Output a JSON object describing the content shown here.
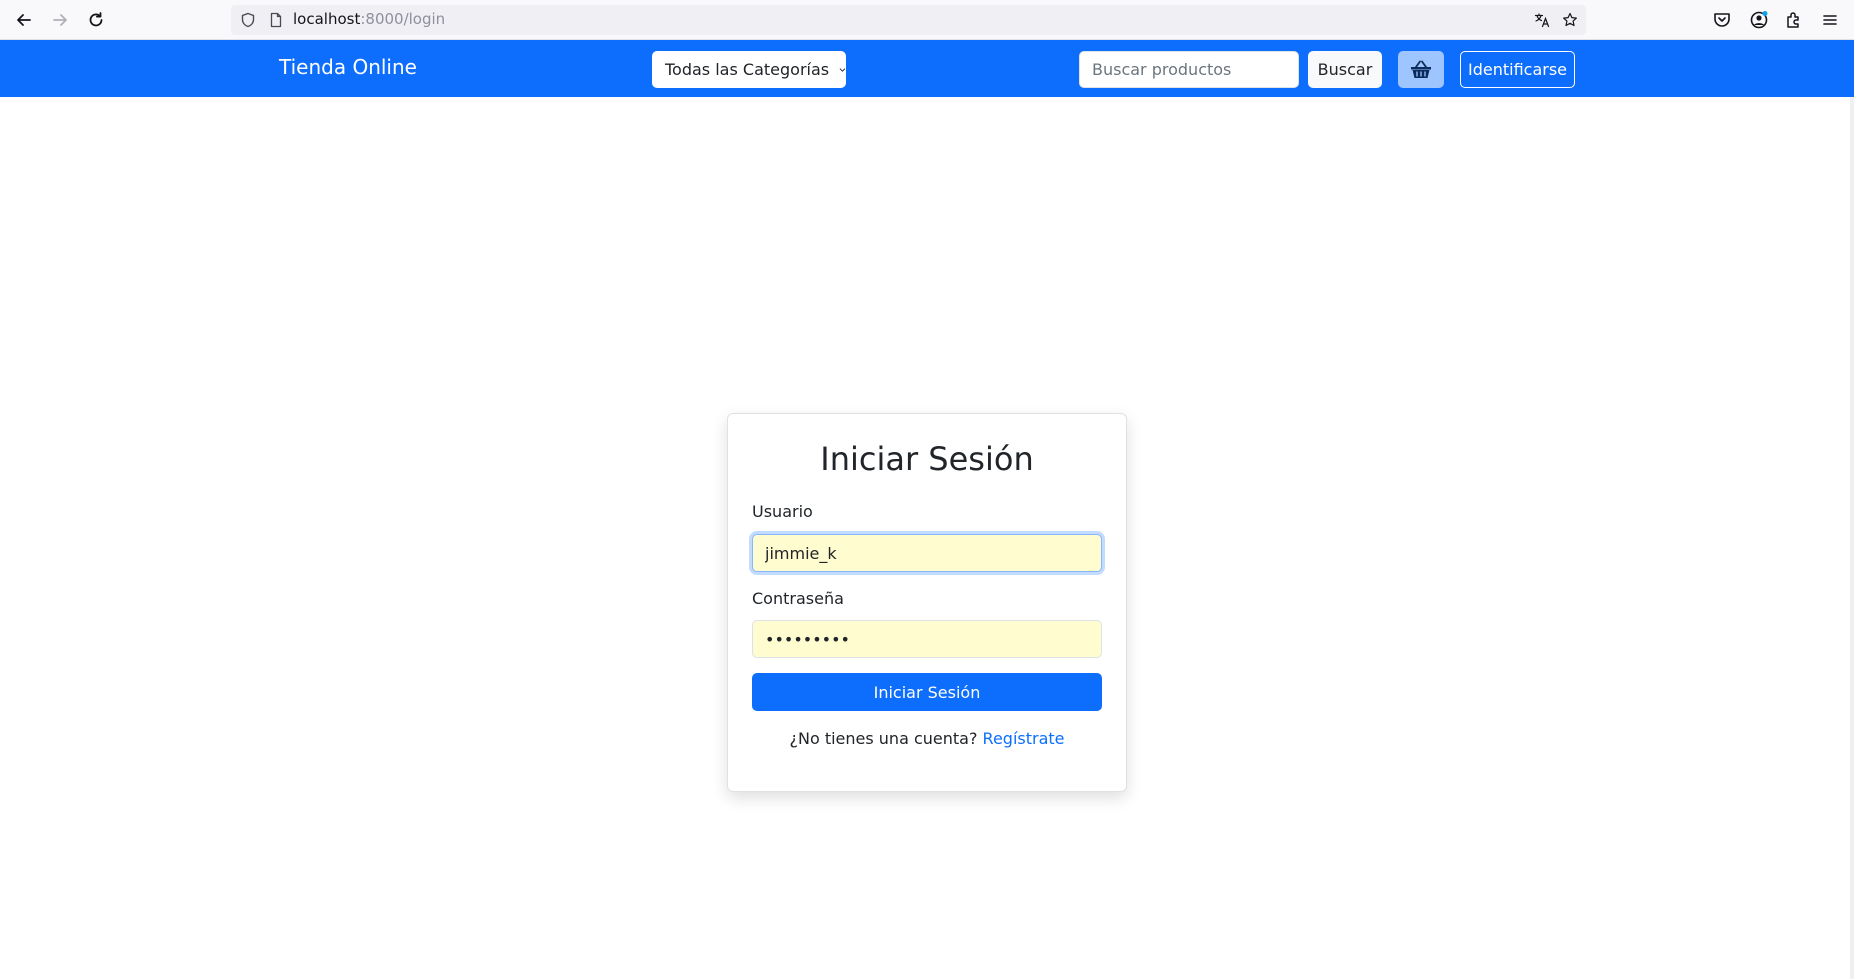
{
  "browser": {
    "url_host": "localhost",
    "url_rest": ":8000/login"
  },
  "navbar": {
    "brand": "Tienda Online",
    "category_dropdown": "Todas las Categorías",
    "search_placeholder": "Buscar productos",
    "search_button": "Buscar",
    "login_button": "Identificarse"
  },
  "login": {
    "title": "Iniciar Sesión",
    "username_label": "Usuario",
    "username_value": "jimmie_k",
    "password_label": "Contraseña",
    "password_value": "•••••••••",
    "submit_button": "Iniciar Sesión",
    "register_prompt": "¿No tienes una cuenta?",
    "register_link": "Regístrate"
  },
  "colors": {
    "primary": "#0d6efd",
    "autofill": "#fffccf"
  }
}
